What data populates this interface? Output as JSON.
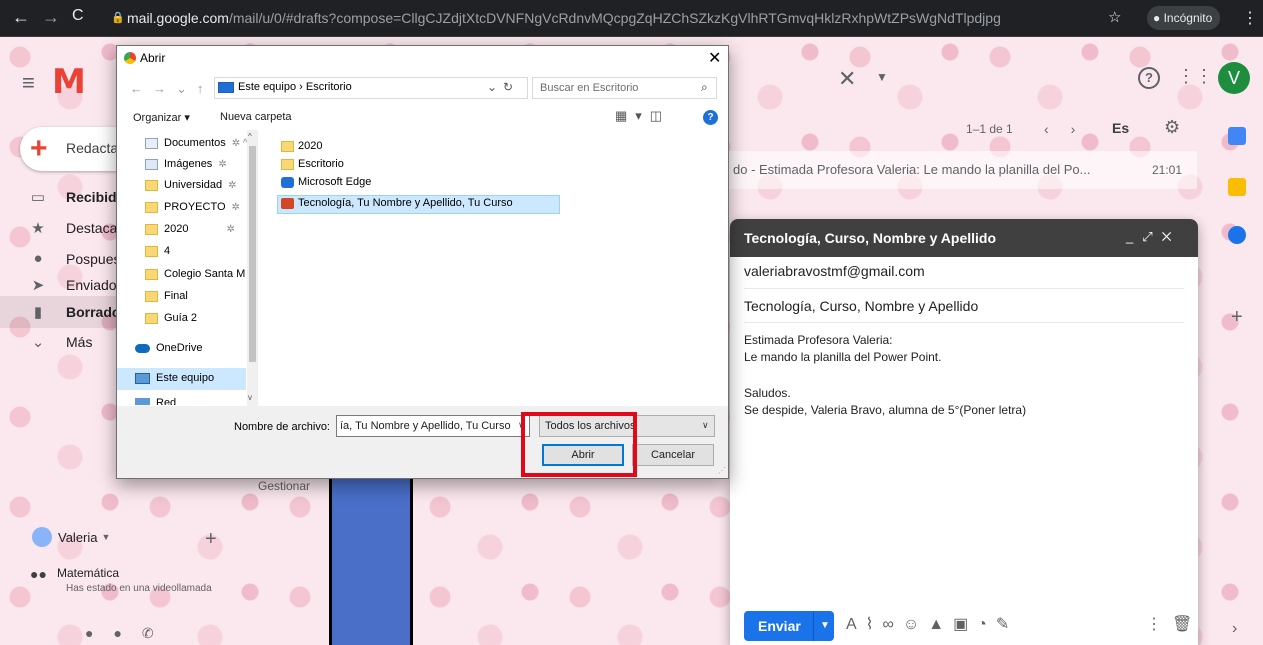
{
  "browser": {
    "url_host": "mail.google.com",
    "url_path": "/mail/u/0/#drafts?compose=CllgCJZdjtXtcDVNFNgVcRdnvMQcpgZqHZChSZkzKgVlhRTGmvqHklzRxhpWtZPsWgNdTlpdjpg",
    "incognito_label": "Incógnito"
  },
  "gmail": {
    "avatar_letter": "V",
    "compose_label": "Redacta",
    "nav": [
      {
        "label": "Recibido",
        "icon": "inbox-icon",
        "bold": true
      },
      {
        "label": "Destaca",
        "icon": "star-icon",
        "bold": false
      },
      {
        "label": "Pospues",
        "icon": "clock-icon",
        "bold": false
      },
      {
        "label": "Enviado",
        "icon": "send-icon",
        "bold": false
      },
      {
        "label": "Borrador",
        "icon": "draft-icon",
        "bold": true
      },
      {
        "label": "Más",
        "icon": "chevron-down-icon",
        "bold": false
      }
    ],
    "user_name": "Valeria",
    "meet_title": "Matemática",
    "meet_sub": "Has estado en una videollamada",
    "gestionar": "Gestionar",
    "pagination": "1–1 de 1",
    "language": "Es",
    "mail_snippet": "do - Estimada Profesora Valeria: Le mando la planilla del Po...",
    "mail_time": "21:01"
  },
  "compose": {
    "title": "Tecnología, Curso, Nombre y Apellido",
    "to": "valeriabravostmf@gmail.com",
    "subject": "Tecnología, Curso, Nombre y Apellido",
    "body_line1": "Estimada Profesora Valeria:",
    "body_line2": "Le mando la planilla del Power Point.",
    "body_line3": "Saludos.",
    "body_line4": "Se despide, Valeria Bravo, alumna de 5°(Poner letra)",
    "send_label": "Enviar"
  },
  "dialog": {
    "title": "Abrir",
    "address": "Este equipo  ›  Escritorio",
    "search_placeholder": "Buscar en Escritorio",
    "organize_label": "Organizar ▾",
    "new_folder_label": "Nueva carpeta",
    "tree": [
      {
        "label": "Documentos",
        "pinned": true,
        "type": "doc"
      },
      {
        "label": "Imágenes",
        "pinned": true,
        "type": "img"
      },
      {
        "label": "Universidad",
        "pinned": true,
        "type": "folder"
      },
      {
        "label": "PROYECTO",
        "pinned": true,
        "type": "folder"
      },
      {
        "label": "2020",
        "pinned": true,
        "type": "folder"
      },
      {
        "label": "4",
        "pinned": false,
        "type": "folder"
      },
      {
        "label": "Colegio Santa M",
        "pinned": false,
        "type": "folder"
      },
      {
        "label": "Final",
        "pinned": false,
        "type": "folder"
      },
      {
        "label": "Guía 2",
        "pinned": false,
        "type": "folder"
      },
      {
        "label": "OneDrive",
        "pinned": false,
        "type": "cloud"
      },
      {
        "label": "Este equipo",
        "pinned": false,
        "type": "pc"
      },
      {
        "label": "Red",
        "pinned": false,
        "type": "net"
      }
    ],
    "files": [
      {
        "label": "2020",
        "type": "folder"
      },
      {
        "label": "Escritorio",
        "type": "folder"
      },
      {
        "label": "Microsoft Edge",
        "type": "edge"
      },
      {
        "label": "Tecnología, Tu Nombre y Apellido, Tu Curso",
        "type": "ppt"
      }
    ],
    "filename_label": "Nombre de archivo:",
    "filename_value": "ía, Tu Nombre y Apellido, Tu Curso",
    "filetype_value": "Todos los archivos",
    "open_label": "Abrir",
    "cancel_label": "Cancelar"
  },
  "colors": {
    "highlight": "#e1081b",
    "send_blue": "#1a73e8",
    "compose_header": "#404040"
  }
}
